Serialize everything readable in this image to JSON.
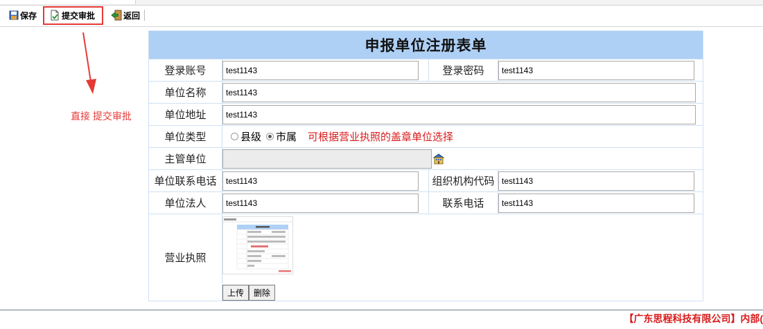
{
  "toolbar": {
    "save_label": "保存",
    "submit_label": "提交审批",
    "back_label": "返回"
  },
  "annotation": {
    "note": "直接 提交审批"
  },
  "form": {
    "title": "申报单位注册表单",
    "login_account_label": "登录账号",
    "login_account_value": "test1143",
    "login_password_label": "登录密码",
    "login_password_value": "test1143",
    "unit_name_label": "单位名称",
    "unit_name_value": "test1143",
    "unit_address_label": "单位地址",
    "unit_address_value": "test1143",
    "unit_type_label": "单位类型",
    "unit_type_options": [
      "县级",
      "市属"
    ],
    "unit_type_selected": "市属",
    "unit_type_hint": "可根据营业执照的盖章单位选择",
    "supervisor_label": "主管单位",
    "supervisor_value": "",
    "contact_phone_label": "单位联系电话",
    "contact_phone_value": "test1143",
    "org_code_label": "组织机构代码",
    "org_code_value": "test1143",
    "legal_person_label": "单位法人",
    "legal_person_value": "test1143",
    "phone_label": "联系电话",
    "phone_value": "test1143",
    "license_label": "营业执照",
    "upload_label": "上传",
    "delete_label": "删除"
  },
  "footer": {
    "text": "【广东思程科技有限公司】内部(",
    "color": "#d81b1b"
  },
  "colors": {
    "title_bg": "#aed0f5",
    "annotation": "#e53935"
  }
}
